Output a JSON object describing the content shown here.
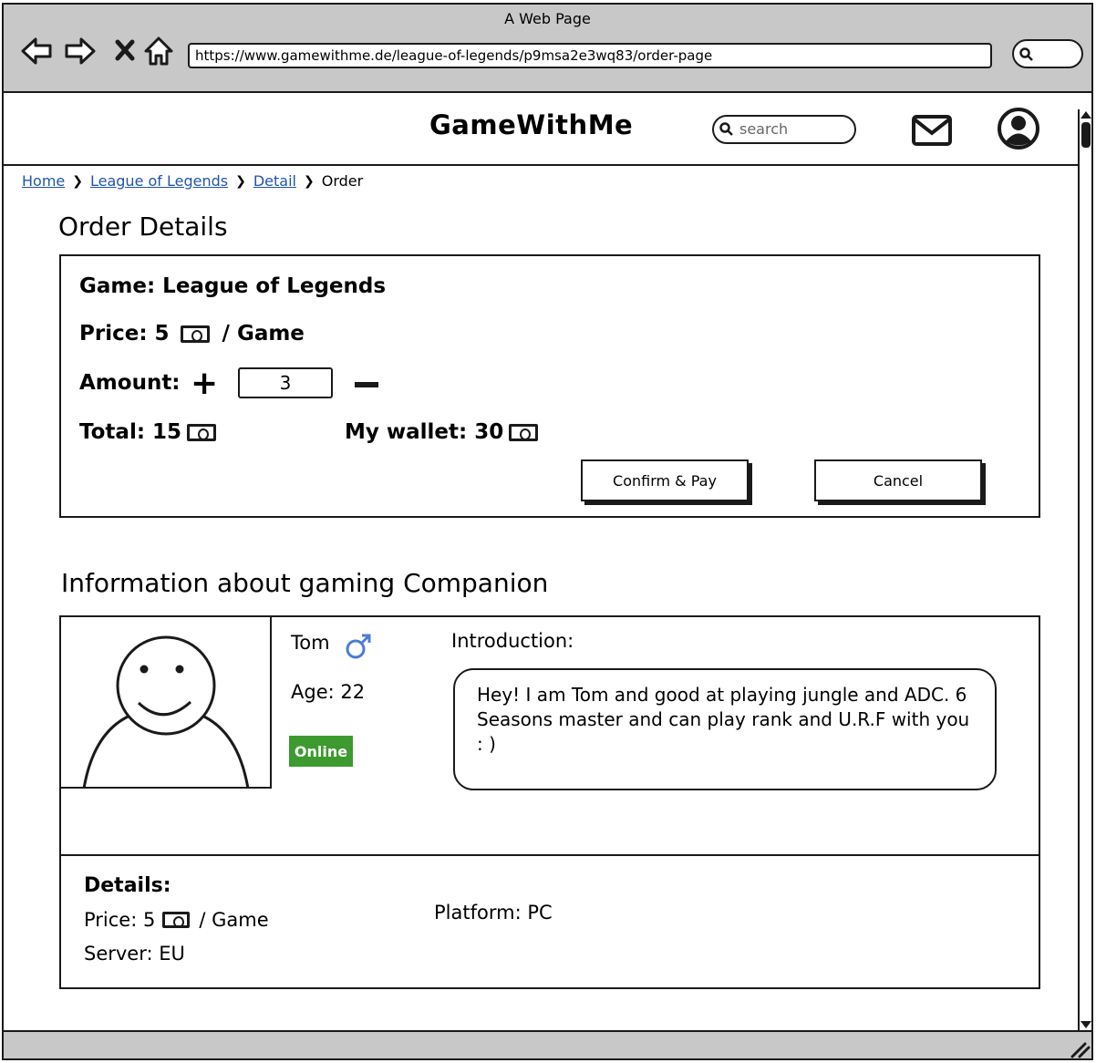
{
  "browser": {
    "window_title": "A Web Page",
    "url": "https://www.gamewithme.de/league-of-legends/p9msa2e3wq83/order-page",
    "nav_icons": [
      "back-icon",
      "forward-icon",
      "close-icon",
      "home-icon"
    ]
  },
  "header": {
    "logo": "GameWithMe",
    "search_placeholder": "search",
    "icons": [
      "mail-icon",
      "user-icon"
    ]
  },
  "breadcrumb": {
    "items": [
      "Home",
      "League of Legends",
      "Detail"
    ],
    "current": "Order"
  },
  "order": {
    "title": "Order Details",
    "game_label": "Game: League of Legends",
    "price_label": "Price: 5",
    "price_unit": "/ Game",
    "amount_label": "Amount:",
    "amount_value": "3",
    "total_label": "Total: 15",
    "wallet_label": "My wallet: 30",
    "confirm_button": "Confirm & Pay",
    "cancel_button": "Cancel"
  },
  "companion": {
    "title": "Information about gaming Companion",
    "name": "Tom",
    "gender_icon": "male-icon",
    "age": "Age: 22",
    "status": "Online",
    "status_color": "#3c9a2e",
    "intro_label": "Introduction:",
    "intro_text": "Hey! I am Tom and good at playing jungle and ADC. 6 Seasons master and can play rank and U.R.F with you : )",
    "details": {
      "heading": "Details:",
      "price_label": "Price: 5",
      "price_unit": "/ Game",
      "server": "Server: EU",
      "platform": "Platform: PC"
    }
  }
}
